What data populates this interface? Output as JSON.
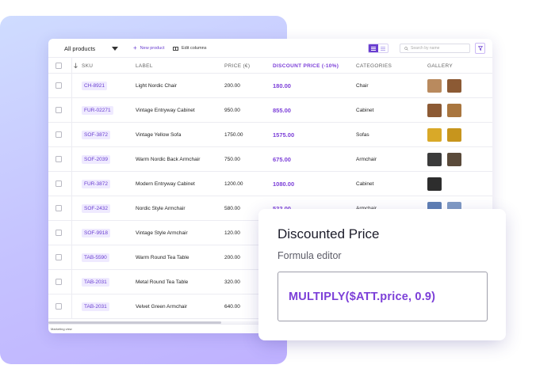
{
  "toolbar": {
    "view_select": "All products",
    "new_product": "New product",
    "edit_columns": "Edit columns",
    "search_placeholder": "Search by name"
  },
  "table": {
    "headers": {
      "sku": "SKU",
      "label": "LABEL",
      "price": "PRICE (€)",
      "discount": "DISCOUNT PRICE (-10%)",
      "categories": "CATEGORIES",
      "gallery": "GALLERY"
    },
    "rows": [
      {
        "sku": "CH-8921",
        "label": "Light Nordic Chair",
        "price": "200.00",
        "discount": "180.00",
        "category": "Chair"
      },
      {
        "sku": "FUR-02271",
        "label": "Vintage Entryway Cabinet",
        "price": "950.00",
        "discount": "855.00",
        "category": "Cabinet"
      },
      {
        "sku": "SOF-3872",
        "label": "Vintage Yellow Sofa",
        "price": "1750.00",
        "discount": "1575.00",
        "category": "Sofas"
      },
      {
        "sku": "SOF-2039",
        "label": "Warm Nordic Back Armchair",
        "price": "750.00",
        "discount": "675.00",
        "category": "Armchair"
      },
      {
        "sku": "FUR-3872",
        "label": "Modern Entryway Cabinet",
        "price": "1200.00",
        "discount": "1080.00",
        "category": "Cabinet"
      },
      {
        "sku": "SOF-2432",
        "label": "Nordic Style Armchair",
        "price": "580.00",
        "discount": "522.00",
        "category": "Armchair"
      },
      {
        "sku": "SOF-9918",
        "label": "Vintage Style Armchair",
        "price": "120.00",
        "discount": "",
        "category": ""
      },
      {
        "sku": "TAB-5590",
        "label": "Warm Round Tea Table",
        "price": "200.00",
        "discount": "",
        "category": ""
      },
      {
        "sku": "TAB-2031",
        "label": "Metal Round Tea Table",
        "price": "320.00",
        "discount": "",
        "category": ""
      },
      {
        "sku": "TAB-2031",
        "label": "Velvet Green Armchair",
        "price": "640.00",
        "discount": "",
        "category": ""
      }
    ]
  },
  "footer": {
    "view_name": "Marketing view"
  },
  "formula": {
    "title": "Discounted Price",
    "subtitle": "Formula editor",
    "expression": "MULTIPLY($ATT.price, 0.9)"
  },
  "colors": {
    "accent": "#7c3fd8",
    "sku_bg": "#efeaff"
  },
  "icons": [
    "chevron-down-icon",
    "plus-icon",
    "columns-icon",
    "list-view-icon",
    "grid-view-icon",
    "search-icon",
    "filter-icon",
    "sort-arrow-icon"
  ]
}
